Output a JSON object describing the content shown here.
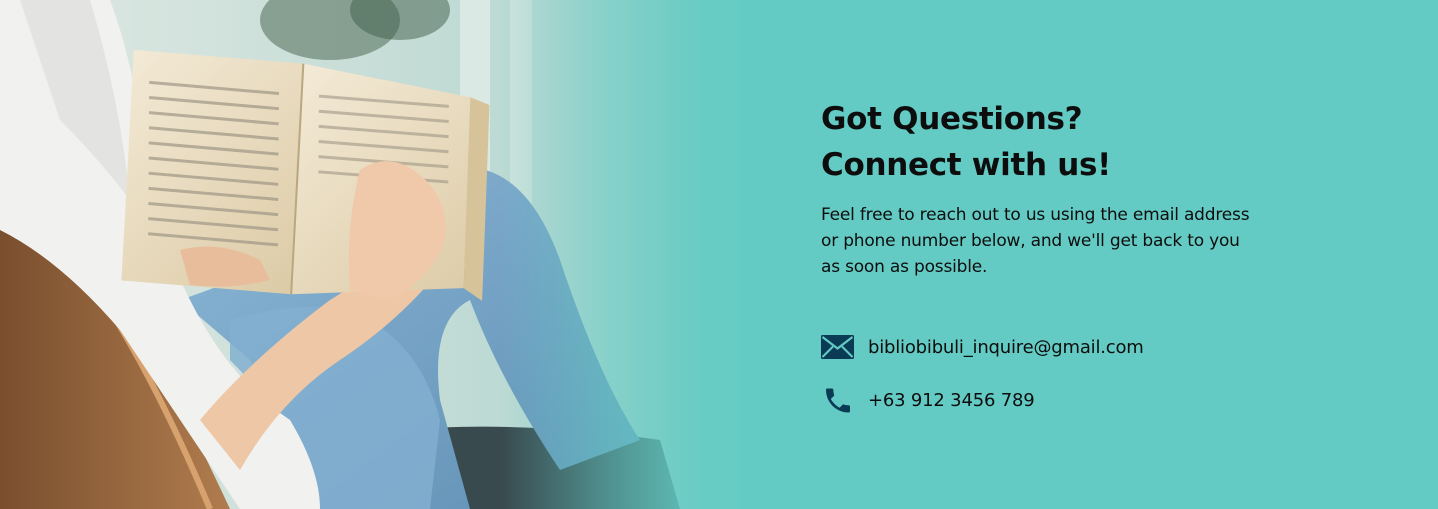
{
  "heading": {
    "line1": "Got Questions?",
    "line2": "Connect with us!"
  },
  "description": "Feel free to reach out to us using the email address or phone number below, and we'll get back to you as soon as possible.",
  "contacts": [
    {
      "icon": "envelope-icon",
      "text": "bibliobibuli_inquire@gmail.com"
    },
    {
      "icon": "phone-icon",
      "text": "+63 912 3456 789"
    }
  ],
  "image": {
    "subject": "person-reading-book-photo"
  },
  "colors": {
    "background": "#63cbc4",
    "icon": "#0b3a55",
    "text": "#0d0d0d"
  }
}
